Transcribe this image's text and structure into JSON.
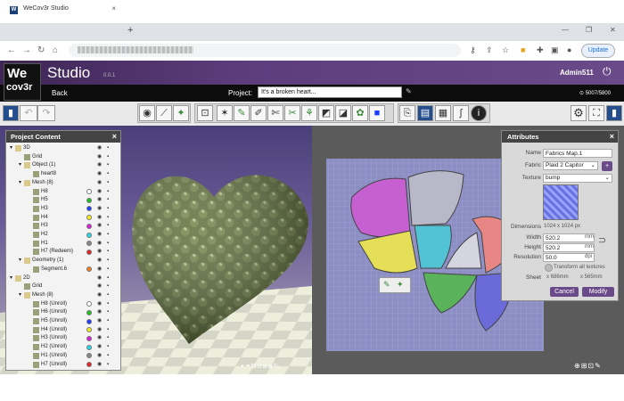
{
  "browser": {
    "tab_title": "WeCov3r Studio",
    "tab_close": "×",
    "new_tab": "+",
    "update_label": "Update"
  },
  "app": {
    "logo_line1": "We",
    "logo_line2": "cov3r",
    "title": "Studio",
    "version": "0.0.1",
    "user": "Admin511",
    "back_label": "Back",
    "project_label": "Project:",
    "project_name": "It's a broken heart...",
    "counter": "5007/5800"
  },
  "project_panel": {
    "title": "Project Content",
    "close": "×",
    "rows": [
      {
        "indent": 0,
        "label": "3D",
        "type": "folder",
        "swatch": ""
      },
      {
        "indent": 1,
        "label": "Grid",
        "type": "item",
        "swatch": ""
      },
      {
        "indent": 1,
        "label": "Object (1)",
        "type": "folder",
        "swatch": ""
      },
      {
        "indent": 2,
        "label": "heart8",
        "type": "item",
        "swatch": ""
      },
      {
        "indent": 1,
        "label": "Mesh (8)",
        "type": "folder",
        "swatch": ""
      },
      {
        "indent": 2,
        "label": "H8",
        "type": "item",
        "swatch": "#ffffff"
      },
      {
        "indent": 2,
        "label": "H5",
        "type": "item",
        "swatch": "#22c022"
      },
      {
        "indent": 2,
        "label": "H3",
        "type": "item",
        "swatch": "#1e3cff"
      },
      {
        "indent": 2,
        "label": "H4",
        "type": "item",
        "swatch": "#f5ee1c"
      },
      {
        "indent": 2,
        "label": "H3",
        "type": "item",
        "swatch": "#d61fd6"
      },
      {
        "indent": 2,
        "label": "H2",
        "type": "item",
        "swatch": "#28d8e6"
      },
      {
        "indent": 2,
        "label": "H1",
        "type": "item",
        "swatch": "#888888"
      },
      {
        "indent": 2,
        "label": "H7 (Redeem)",
        "type": "item",
        "swatch": "#e52222"
      },
      {
        "indent": 1,
        "label": "Geometry (1)",
        "type": "folder",
        "swatch": ""
      },
      {
        "indent": 2,
        "label": "Segment.6",
        "type": "item",
        "swatch": "#f08020"
      },
      {
        "indent": 0,
        "label": "2D",
        "type": "folder",
        "swatch": ""
      },
      {
        "indent": 1,
        "label": "Grid",
        "type": "item",
        "swatch": ""
      },
      {
        "indent": 1,
        "label": "Mesh (8)",
        "type": "folder",
        "swatch": ""
      },
      {
        "indent": 2,
        "label": "H8 (Unroll)",
        "type": "item",
        "swatch": "#ffffff"
      },
      {
        "indent": 2,
        "label": "H6 (Unroll)",
        "type": "item",
        "swatch": "#22c022"
      },
      {
        "indent": 2,
        "label": "H5 (Unroll)",
        "type": "item",
        "swatch": "#1e3cff"
      },
      {
        "indent": 2,
        "label": "H4 (Unroll)",
        "type": "item",
        "swatch": "#f5ee1c"
      },
      {
        "indent": 2,
        "label": "H3 (Unroll)",
        "type": "item",
        "swatch": "#d61fd6"
      },
      {
        "indent": 2,
        "label": "H2 (Unroll)",
        "type": "item",
        "swatch": "#28d8e6"
      },
      {
        "indent": 2,
        "label": "H1 (Unroll)",
        "type": "item",
        "swatch": "#888888"
      },
      {
        "indent": 2,
        "label": "H7 (Unroll)",
        "type": "item",
        "swatch": "#e52222"
      }
    ]
  },
  "attributes": {
    "title": "Attributes",
    "close": "×",
    "name_label": "Name",
    "name_value": "Fabrics Map.1",
    "fabric_label": "Fabric",
    "fabric_value": "Plaid 2 Capitor",
    "texture_label": "Texture",
    "texture_value": "bump",
    "dimensions_label": "Dimensions",
    "dimensions_value": "1024 x 1024 px",
    "width_label": "Width",
    "width_value": "520.2",
    "width_unit": "mm",
    "height_label": "Height",
    "height_value": "520.2",
    "height_unit": "mm",
    "resolution_label": "Resolution",
    "resolution_value": "50.0",
    "resolution_unit": "dpi",
    "transform_label": "Transform all textures",
    "sheet_label": "Sheet",
    "sheet_w": "x 686mm",
    "sheet_h": "x 565mm",
    "cancel_label": "Cancel",
    "modify_label": "Modify",
    "add_label": "+"
  },
  "colors": {
    "header_purple": "#5e3d7d",
    "accent": "#6a4a88",
    "heart_green": "#5d6e3a"
  }
}
